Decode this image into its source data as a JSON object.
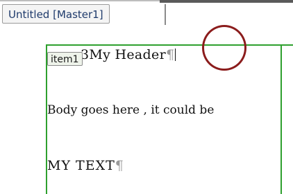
{
  "document_tab": {
    "title": "Untitled [Master1]"
  },
  "text_box": {
    "item_label": "item1",
    "header_prefix": "3",
    "header_text": "My Header",
    "body_text": "Body goes here , it could be",
    "my_text": "MY TEXT",
    "pilcrow": "¶"
  },
  "colors": {
    "frame_border": "#2ea02e",
    "highlight_circle": "#8b1c1c",
    "tab_text": "#1e3a6b"
  }
}
